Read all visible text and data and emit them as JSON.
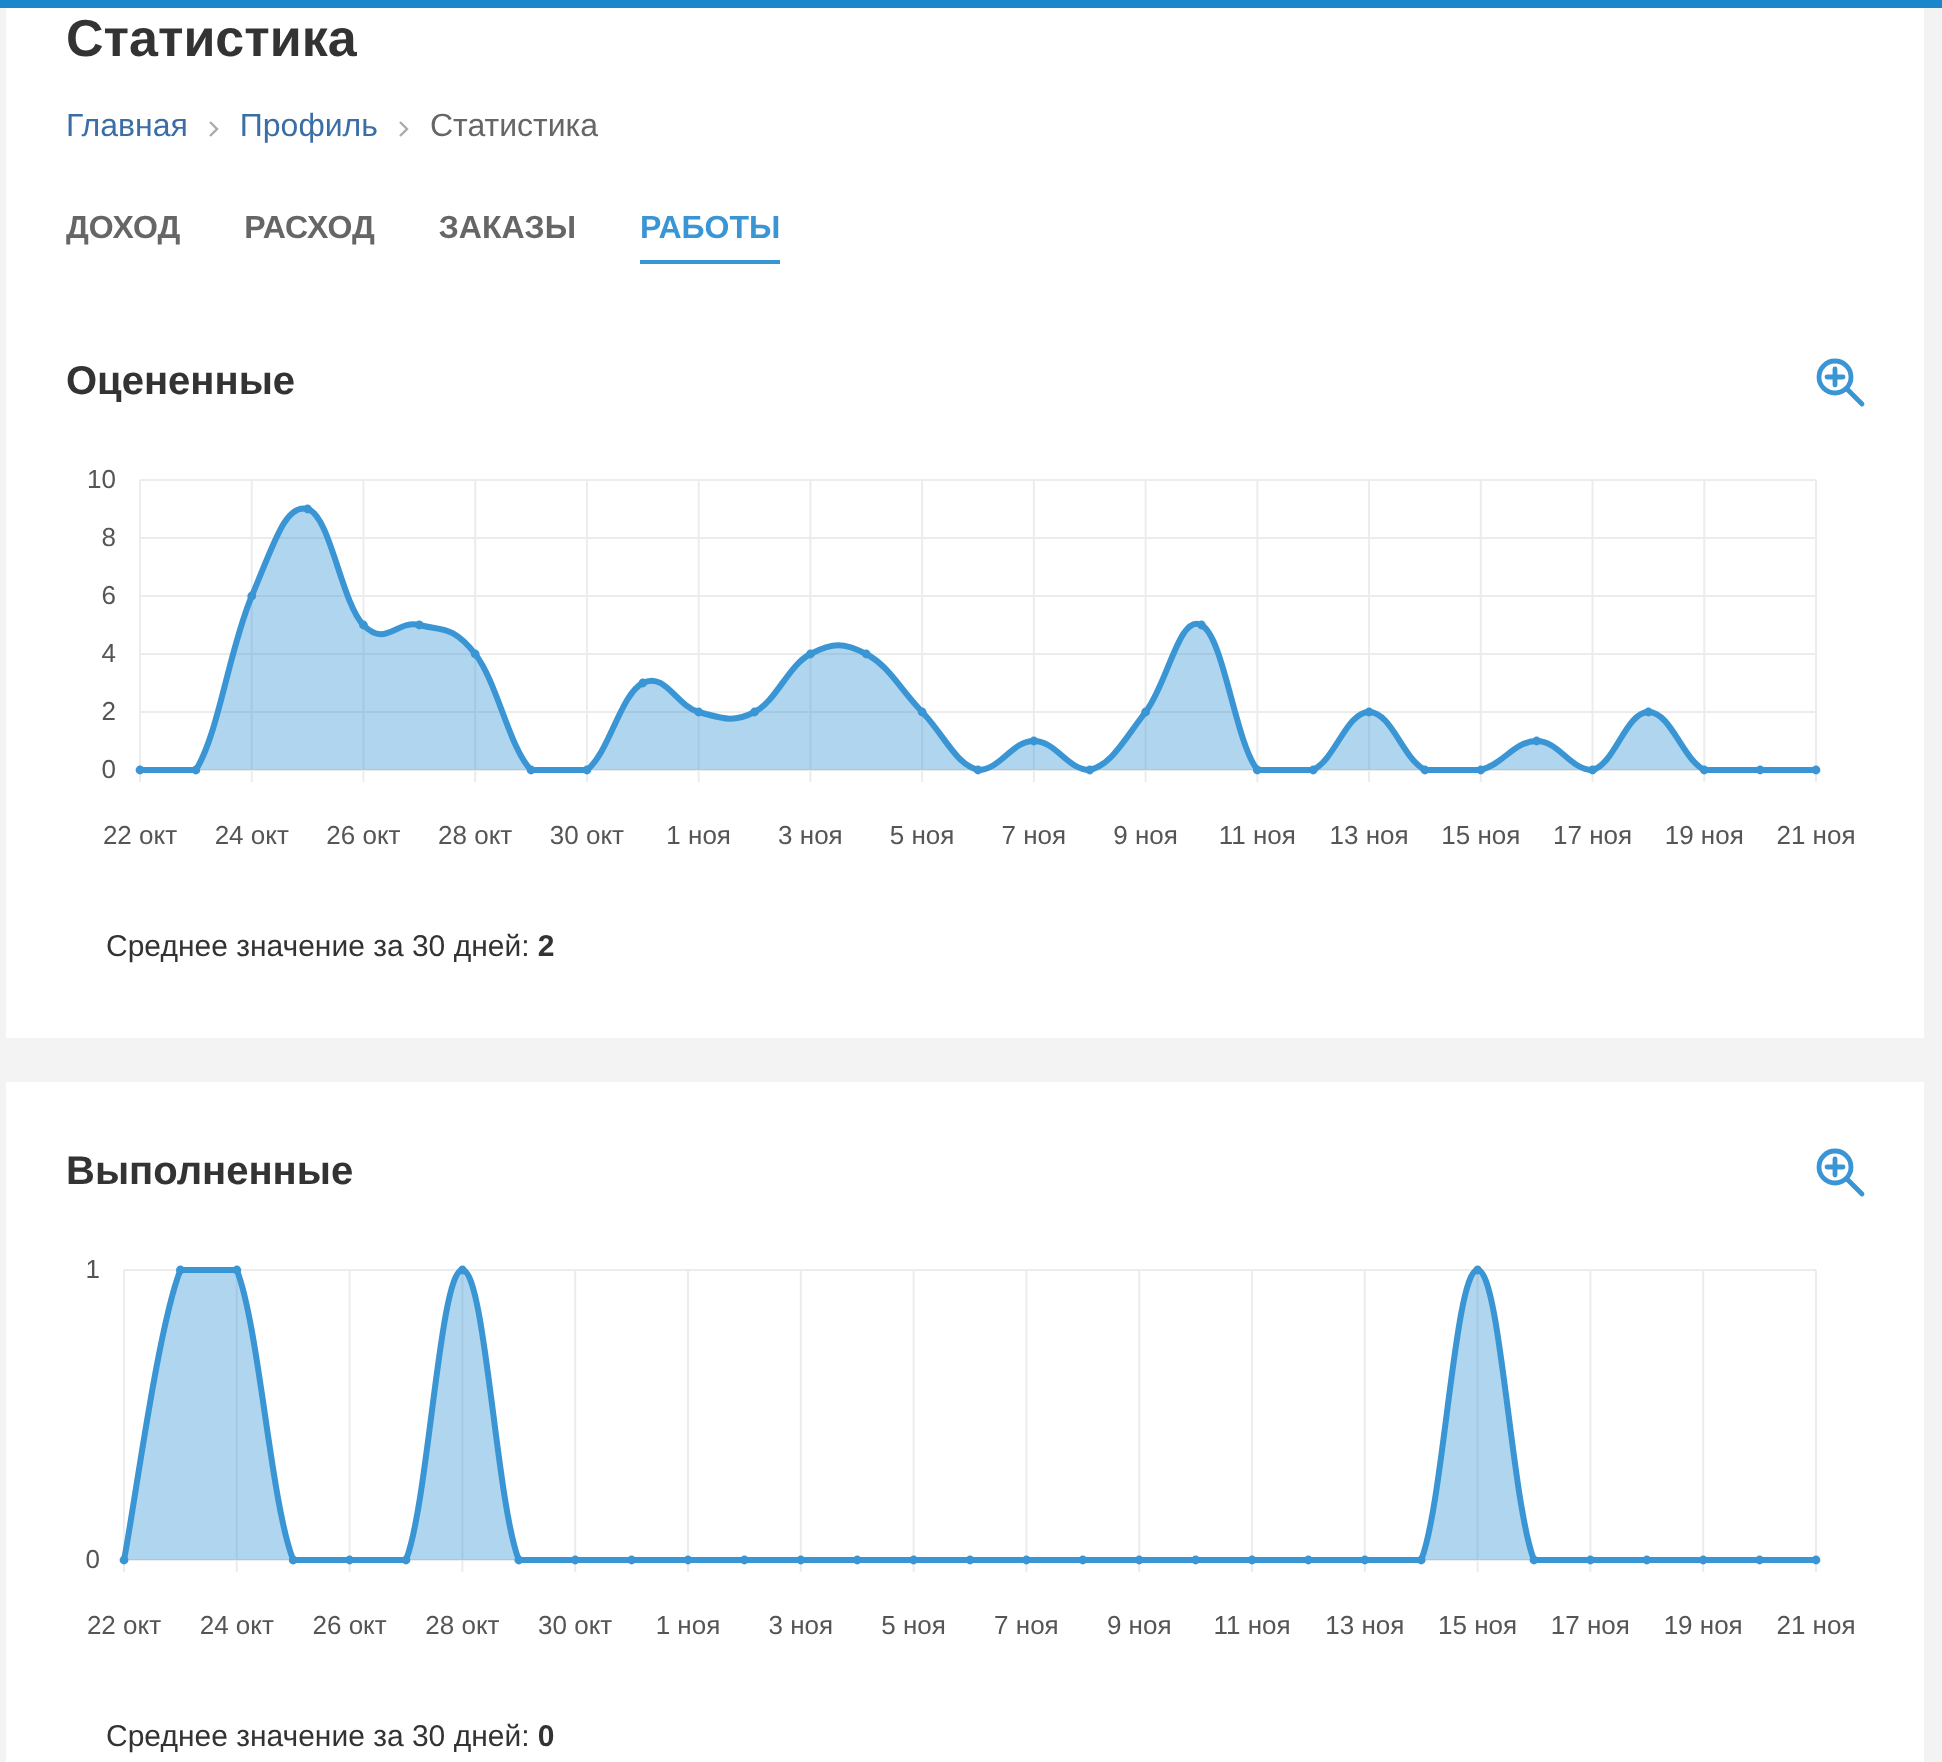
{
  "page": {
    "title": "Статистика"
  },
  "breadcrumbs": [
    {
      "label": "Главная",
      "kind": "link"
    },
    {
      "label": "Профиль",
      "kind": "link"
    },
    {
      "label": "Статистика",
      "kind": "current"
    }
  ],
  "tabs": [
    {
      "label": "ДОХОД",
      "selected": false
    },
    {
      "label": "РАСХОД",
      "selected": false
    },
    {
      "label": "ЗАКАЗЫ",
      "selected": false
    },
    {
      "label": "РАБОТЫ",
      "selected": true
    }
  ],
  "sections": [
    {
      "average_label": "Среднее значение за 30 дней:",
      "average_value": "2",
      "chart_data": {
        "type": "area",
        "grid": true,
        "ylim": [
          0,
          10
        ],
        "yticks": [
          0,
          2,
          4,
          6,
          8,
          10
        ],
        "categories": [
          "22 окт",
          null,
          "24 окт",
          null,
          "26 окт",
          null,
          "28 окт",
          null,
          "30 окт",
          null,
          "1 ноя",
          null,
          "3 ноя",
          null,
          "5 ноя",
          null,
          "7 ноя",
          null,
          "9 ноя",
          null,
          "11 ноя",
          null,
          "13 ноя",
          null,
          "15 ноя",
          null,
          "17 ноя",
          null,
          "19 ноя",
          null,
          "21 ноя"
        ],
        "series": [
          {
            "name": "Оцененные",
            "color": "#3a95d4",
            "values": [
              0,
              0,
              6,
              9,
              5,
              5,
              4,
              0,
              0,
              3,
              2,
              2,
              4,
              4,
              2,
              0,
              1,
              0,
              2,
              5,
              0,
              0,
              2,
              0,
              0,
              1,
              0,
              2,
              0,
              0,
              0
            ]
          }
        ]
      }
    },
    {
      "average_label": "Среднее значение за 30 дней:",
      "average_value": "0",
      "chart_data": {
        "type": "area",
        "grid": true,
        "ylim": [
          0,
          1
        ],
        "yticks": [
          0,
          1
        ],
        "categories": [
          "22 окт",
          null,
          "24 окт",
          null,
          "26 окт",
          null,
          "28 окт",
          null,
          "30 окт",
          null,
          "1 ноя",
          null,
          "3 ноя",
          null,
          "5 ноя",
          null,
          "7 ноя",
          null,
          "9 ноя",
          null,
          "11 ноя",
          null,
          "13 ноя",
          null,
          "15 ноя",
          null,
          "17 ноя",
          null,
          "19 ноя",
          null,
          "21 ноя"
        ],
        "series": [
          {
            "name": "Выполненные",
            "color": "#3a95d4",
            "values": [
              0,
              1,
              1,
              0,
              0,
              0,
              1,
              0,
              0,
              0,
              0,
              0,
              0,
              0,
              0,
              0,
              0,
              0,
              0,
              0,
              0,
              0,
              0,
              0,
              1,
              0,
              0,
              0,
              0,
              0,
              0
            ]
          }
        ]
      }
    }
  ]
}
